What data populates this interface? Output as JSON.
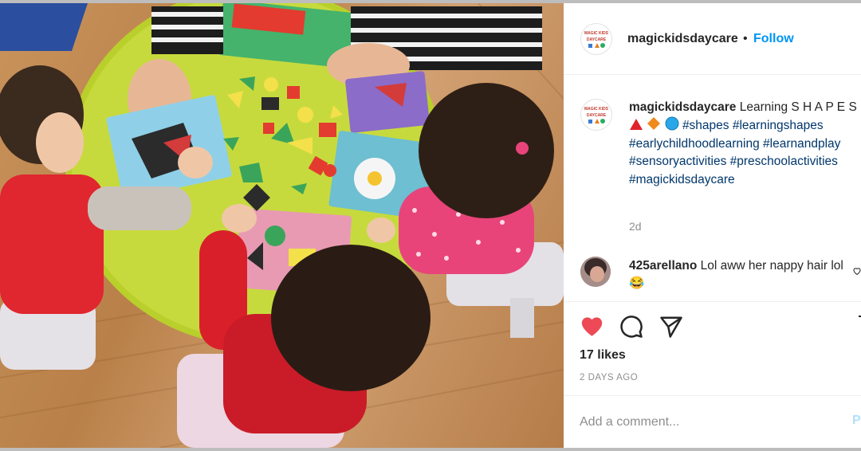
{
  "post": {
    "username": "magickidsdaycare",
    "header_separator": "•",
    "follow_label": "Follow",
    "avatar_text": [
      "MAGIC KIDS",
      "DAYCARE"
    ],
    "caption": {
      "text_lead": "Learning S H A P E S",
      "shapes": [
        "red-triangle",
        "orange-diamond",
        "blue-circle"
      ],
      "hashtags": [
        "#shapes",
        "#learningshapes",
        "#earlychildhoodlearning",
        "#learnandplay",
        "#sensoryactivities",
        "#preschoolactivities",
        "#magickidsdaycare"
      ],
      "age": "2d"
    },
    "comment": {
      "username": "425arellano",
      "text": "Lol aww her nappy hair lol",
      "emoji": "😂"
    },
    "likes": "17 likes",
    "time_ago": "2 DAYS AGO",
    "add_comment_placeholder": "Add a comment...",
    "post_label": "Post"
  },
  "colors": {
    "follow": "#0095f6",
    "hashtag": "#00376b",
    "liked_heart": "#ed4956",
    "muted": "#8e8e8e"
  },
  "photo": {
    "subject": "children doing shape puzzle at a round green table"
  }
}
